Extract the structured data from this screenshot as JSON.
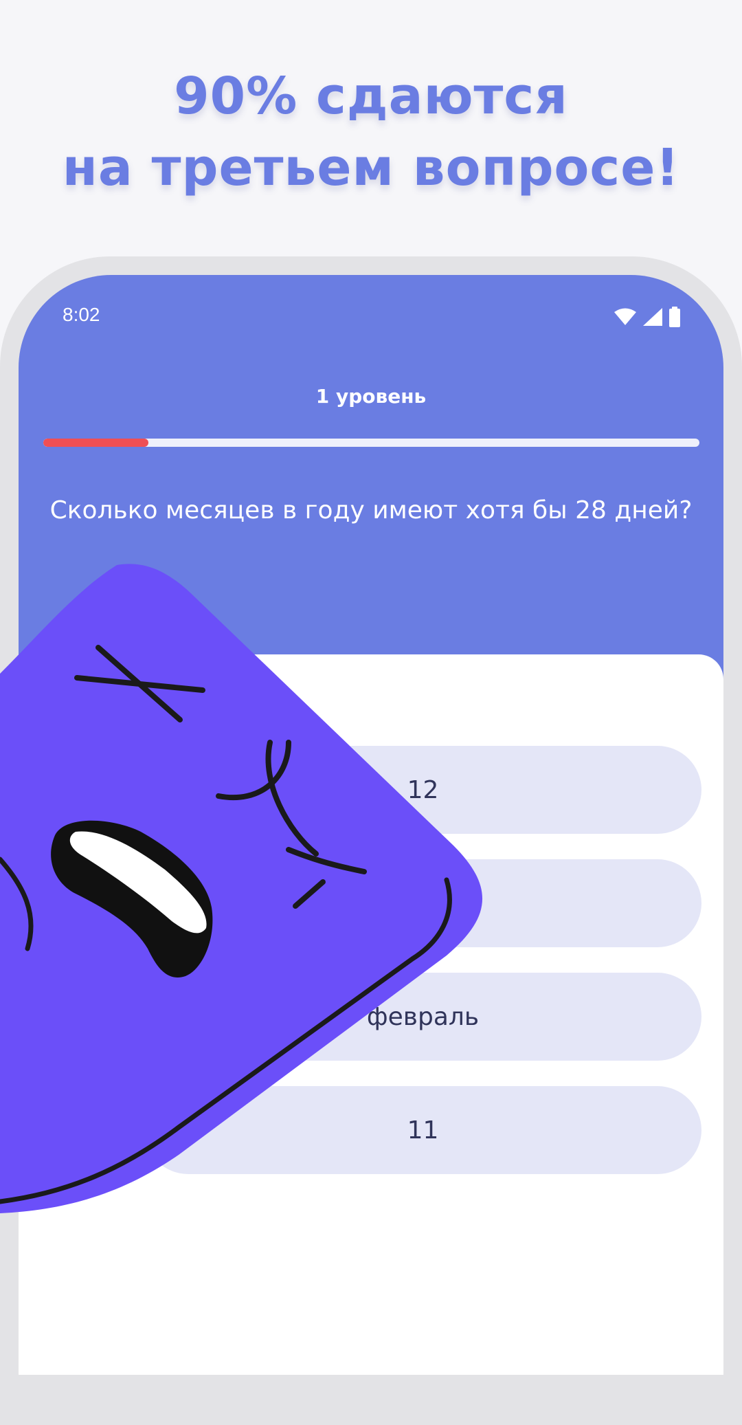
{
  "promo": {
    "line1": "90% сдаются",
    "line2": "на третьем вопросе!"
  },
  "status_bar": {
    "time": "8:02"
  },
  "quiz": {
    "level": "1 уровень",
    "progress": 0.16,
    "question": "Сколько месяцев в году имеют хотя бы 28 дней?",
    "answers": [
      "12",
      "",
      "февраль",
      "11"
    ]
  },
  "colors": {
    "accent": "#6a7de2",
    "progress": "#ef4f55",
    "mascot": "#6b4ff9",
    "answer_bg": "#e4e6f7"
  },
  "icons": [
    "wifi-icon",
    "signal-icon",
    "battery-icon"
  ]
}
